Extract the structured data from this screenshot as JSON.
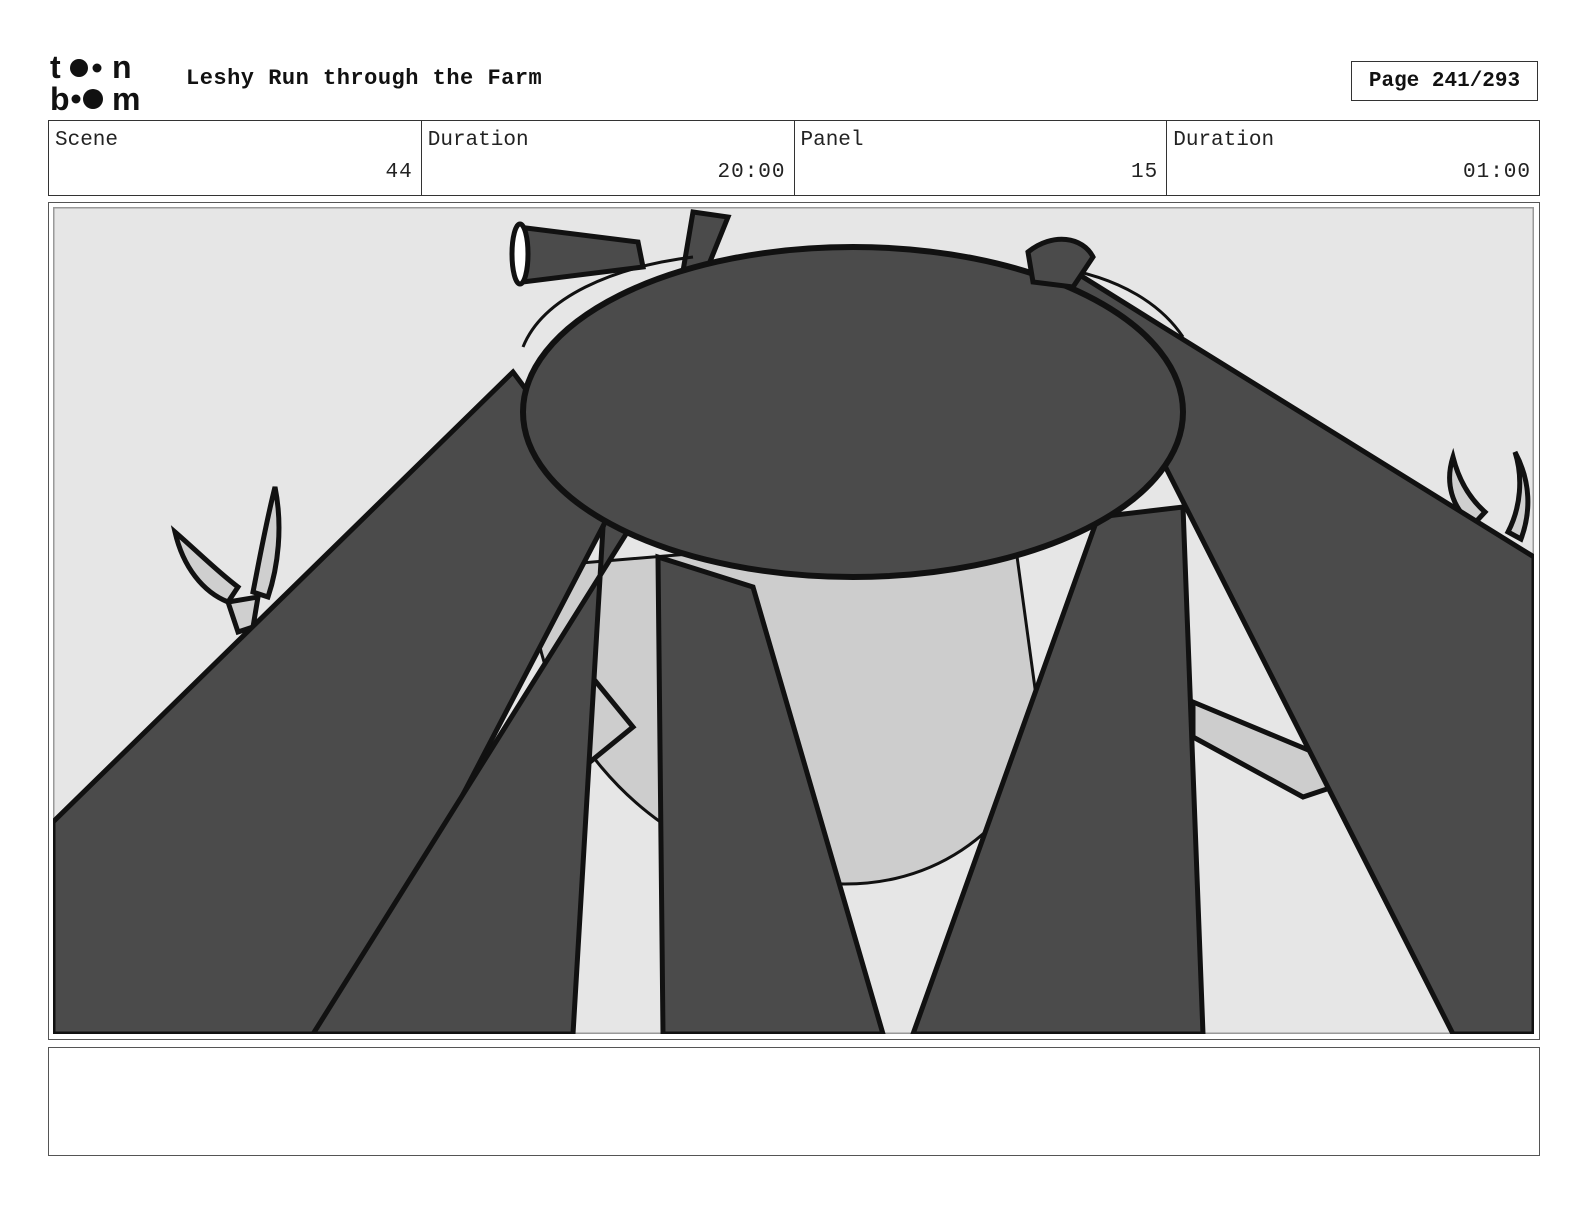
{
  "logo": {
    "line1": "toon",
    "line2": "boom"
  },
  "header": {
    "title": "Leshy Run through the Farm",
    "page_label": "Page 241/293"
  },
  "info": {
    "scene_label": "Scene",
    "scene_value": "44",
    "scene_duration_label": "Duration",
    "scene_duration_value": "20:00",
    "panel_label": "Panel",
    "panel_value": "15",
    "panel_duration_label": "Duration",
    "panel_duration_value": "01:00"
  },
  "notes": {
    "text": ""
  }
}
